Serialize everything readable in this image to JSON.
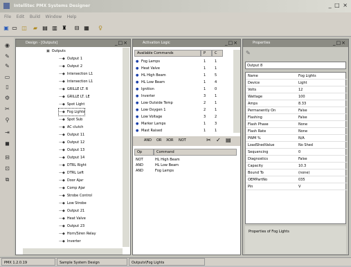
{
  "window": {
    "title": "Intellitec PMX Systems Designer"
  },
  "menu": [
    "File",
    "Edit",
    "Build",
    "Window",
    "Help"
  ],
  "toolbar_icons": [
    "new-icon",
    "open-icon",
    "save-icon",
    "folder-icon",
    "print-icon",
    "find-icon",
    "layout-icon",
    "tool-icon"
  ],
  "design_panel": {
    "title": "Design - [Outputs]",
    "root_label": "Outputs",
    "items": [
      "Output 1",
      "Output 2",
      "Intersection L1",
      "Intersection L1",
      "GRILLE LT. R",
      "GRILLE LT. LE",
      "Spot Light",
      "Fog Lights",
      "Spot Sub",
      "AC clutch",
      "Output 11",
      "Output 12",
      "Output 13",
      "Output 14",
      "DTRL Right",
      "DTRL Left",
      "Door Ajar",
      "Comp Ajar",
      "Strobe Control",
      "Low Strobe",
      "Output 21",
      "Heat Valve",
      "Output 23",
      "Horn/Siren Relay",
      "Inverter"
    ]
  },
  "commands_panel": {
    "title": "Activation Logic",
    "headers": [
      "Available Commands",
      "P",
      "C"
    ],
    "rows": [
      {
        "name": "Fog Lamps",
        "p": "1",
        "c": "1"
      },
      {
        "name": "Heat Valve",
        "p": "1",
        "c": "1"
      },
      {
        "name": "HL High Beam",
        "p": "1",
        "c": "5"
      },
      {
        "name": "HL Low Beam",
        "p": "1",
        "c": "4"
      },
      {
        "name": "Ignition",
        "p": "1",
        "c": "0"
      },
      {
        "name": "Inverter",
        "p": "3",
        "c": "1"
      },
      {
        "name": "Low Outside Temp",
        "p": "2",
        "c": "1"
      },
      {
        "name": "Low Oxygen 1",
        "p": "2",
        "c": "1"
      },
      {
        "name": "Low Voltage",
        "p": "3",
        "c": "2"
      },
      {
        "name": "Marker Lamps",
        "p": "1",
        "c": "3"
      },
      {
        "name": "Mast Raised",
        "p": "1",
        "c": "1"
      }
    ],
    "logic_buttons": [
      "AND",
      "OR",
      "XOR",
      "NOT"
    ],
    "grid_headers": [
      "Op",
      "Command"
    ],
    "grid_rows": [
      {
        "op": "NOT",
        "cmd": "HL High Beam"
      },
      {
        "op": "AND",
        "cmd": "HL Low Beam"
      },
      {
        "op": "AND",
        "cmd": "Fog Lamps"
      }
    ]
  },
  "properties_panel": {
    "title": "Properties",
    "object_name": "Output 8",
    "rows": [
      {
        "n": "Name",
        "v": "Fog Lights"
      },
      {
        "n": "Device",
        "v": "Light"
      },
      {
        "n": "Volts",
        "v": "12"
      },
      {
        "n": "Wattage",
        "v": "100"
      },
      {
        "n": "Amps",
        "v": "8.33"
      },
      {
        "n": "Permanently On",
        "v": "False"
      },
      {
        "n": "Flashing",
        "v": "False"
      },
      {
        "n": "Flash Phase",
        "v": "None"
      },
      {
        "n": "Flash Rate",
        "v": "None"
      },
      {
        "n": "PWM %",
        "v": "N/A"
      },
      {
        "n": "LoadShedValue",
        "v": "No Shed"
      },
      {
        "n": "Sequencing",
        "v": "0"
      },
      {
        "n": "Diagnostics",
        "v": "False"
      },
      {
        "n": "Capacity",
        "v": "10.3"
      },
      {
        "n": "Bound To",
        "v": "(none)"
      },
      {
        "n": "OEMPartNo",
        "v": "035"
      },
      {
        "n": "Pin",
        "v": "V"
      }
    ],
    "description": "Properties of Fog Lights"
  },
  "status": [
    "PMX 1.2.0.19",
    "Sample System Design",
    "Outputs\\Fog Lights"
  ]
}
